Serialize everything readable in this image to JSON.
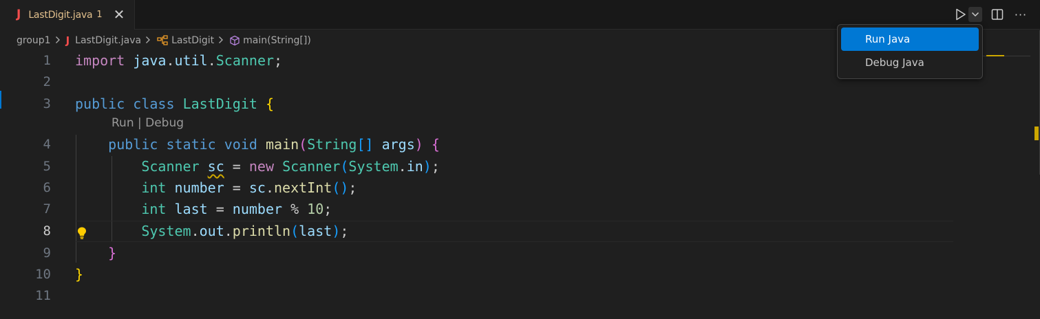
{
  "tab": {
    "icon_letter": "J",
    "title": "LastDigit.java",
    "problems": "1",
    "close_glyph": "✕"
  },
  "breadcrumb": {
    "folder": "group1",
    "file_icon": "J",
    "file": "LastDigit.java",
    "class": "LastDigit",
    "method": "main(String[])"
  },
  "codelens": "Run | Debug",
  "line_numbers": [
    "1",
    "2",
    "3",
    "4",
    "5",
    "6",
    "7",
    "8",
    "9",
    "10",
    "11"
  ],
  "code": {
    "l1": {
      "kw": "import",
      "pkg1": "java",
      "dot1": ".",
      "pkg2": "util",
      "dot2": ".",
      "cls": "Scanner",
      "semi": ";"
    },
    "l3": {
      "kw1": "public",
      "kw2": "class",
      "name": "LastDigit",
      "brace": "{"
    },
    "l4": {
      "kw1": "public",
      "kw2": "static",
      "kw3": "void",
      "fn": "main",
      "p1": "(",
      "type": "String",
      "arr": "[]",
      "arg": "args",
      "p2": ")",
      "brace": "{"
    },
    "l5": {
      "type": "Scanner",
      "var": "sc",
      "eq": " = ",
      "kw": "new",
      "cls": "Scanner",
      "p1": "(",
      "sys": "System",
      "dot": ".",
      "in": "in",
      "p2": ")",
      "semi": ";"
    },
    "l6": {
      "type": "int",
      "var": "number",
      "eq": " = ",
      "obj": "sc",
      "dot": ".",
      "fn": "nextInt",
      "paren": "()",
      "semi": ";"
    },
    "l7": {
      "type": "int",
      "var": "last",
      "eq": " = ",
      "v2": "number",
      "op": " % ",
      "num": "10",
      "semi": ";"
    },
    "l8": {
      "sys": "System",
      "dot1": ".",
      "out": "out",
      "dot2": ".",
      "fn": "println",
      "p1": "(",
      "arg": "last",
      "p2": ")",
      "semi": ";"
    },
    "l9": {
      "brace": "}"
    },
    "l10": {
      "brace": "}"
    }
  },
  "run_menu": {
    "items": [
      "Run Java",
      "Debug Java"
    ],
    "selected_index": 0
  },
  "more_glyph": "···",
  "colors": {
    "accent": "#0078d4",
    "warning": "#cca700",
    "java_icon": "#f14c4c",
    "modified_tab": "#e2c08d"
  }
}
